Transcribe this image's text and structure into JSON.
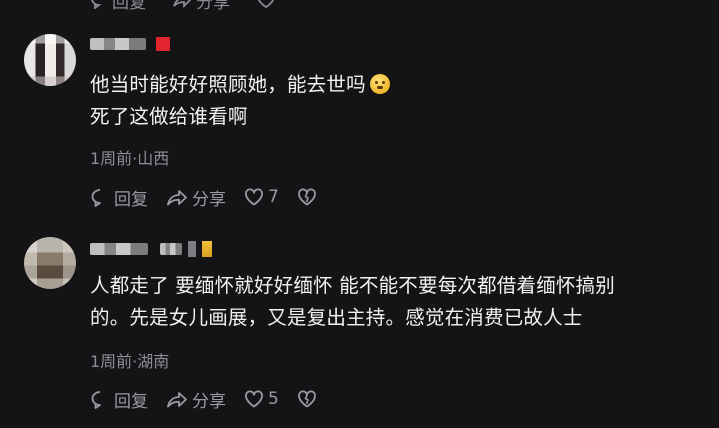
{
  "top_partial": {
    "reply_label": "回复",
    "share_label": "分享"
  },
  "comments": [
    {
      "lines": [
        "他当时能好好照顾她，能去世吗",
        "死了这做给谁看啊"
      ],
      "emoji": "grimacing-face-emoji",
      "meta": "1周前·山西",
      "reply_label": "回复",
      "share_label": "分享",
      "like_count": "7"
    },
    {
      "lines": [
        "人都走了 要缅怀就好好缅怀 能不能不要每次都借着缅怀搞别",
        "的。先是女儿画展，又是复出主持。感觉在消费已故人士"
      ],
      "meta": "1周前·湖南",
      "reply_label": "回复",
      "share_label": "分享",
      "like_count": "5"
    }
  ],
  "colors": {
    "background": "#141416",
    "text": "#f2f2f4",
    "muted": "#8d8d95",
    "badge_red": "#e2242f",
    "badge_gold": "#f2c23c"
  }
}
